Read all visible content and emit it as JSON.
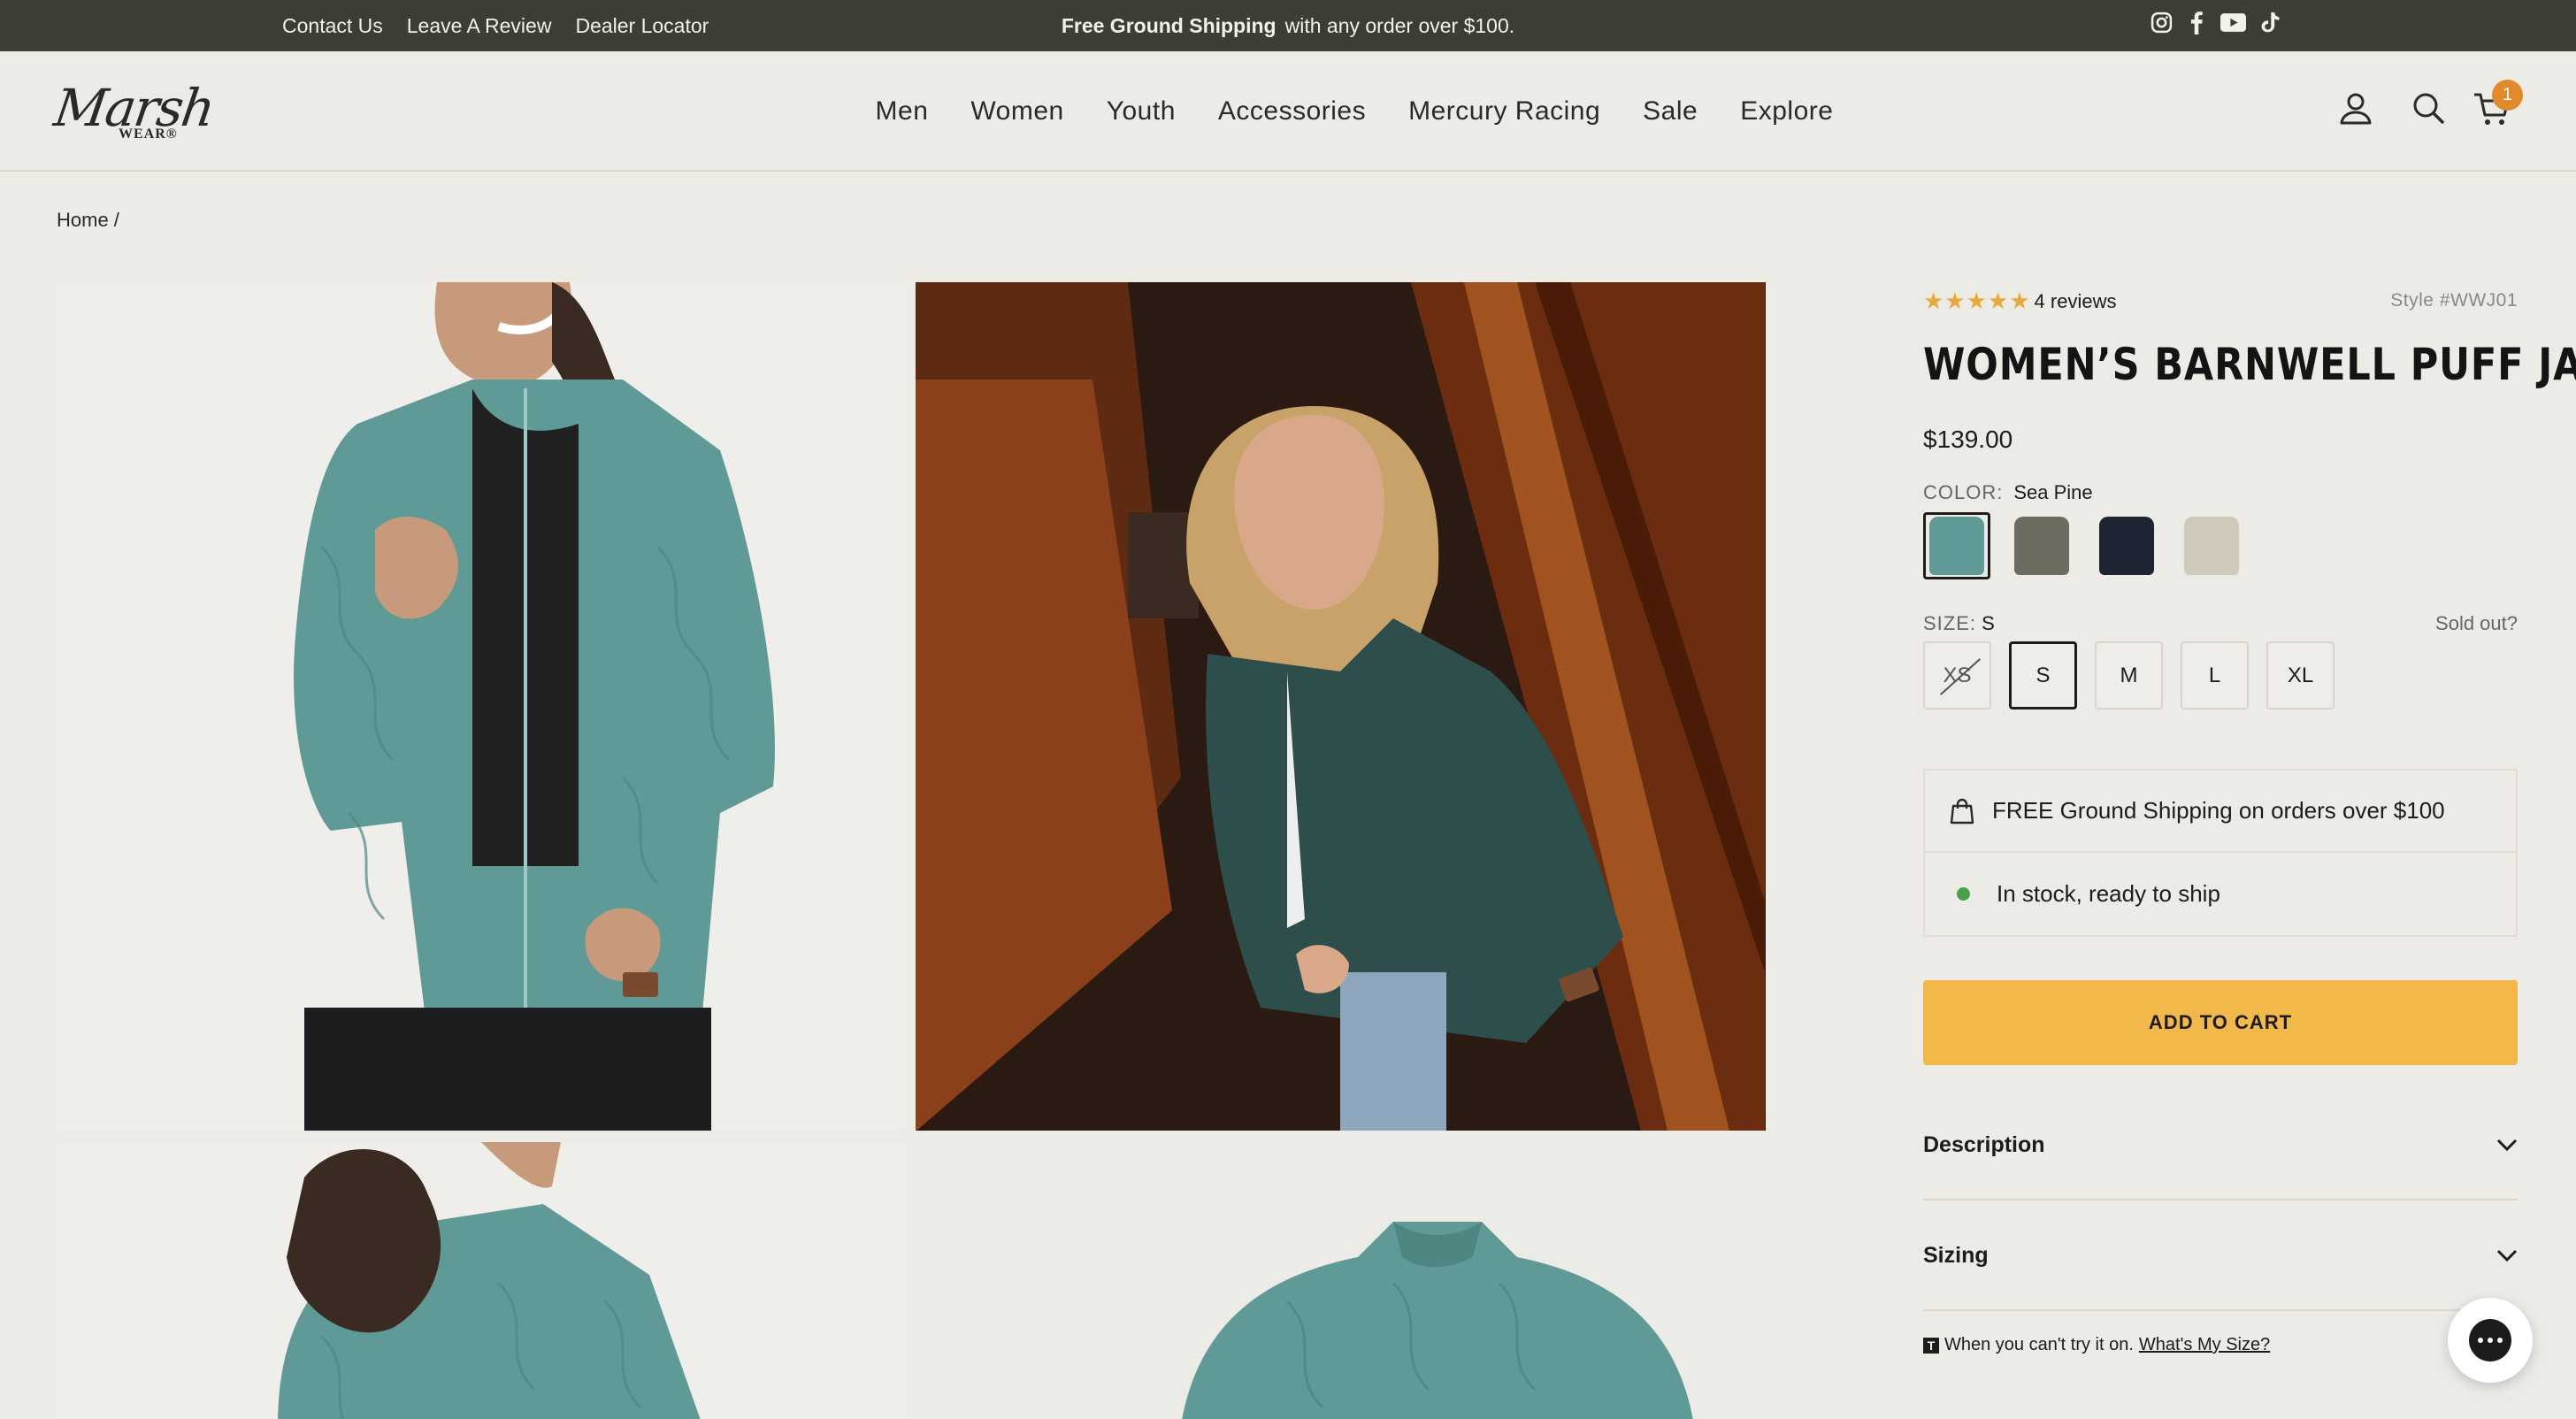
{
  "announcement": {
    "links": [
      "Contact Us",
      "Leave A Review",
      "Dealer Locator"
    ],
    "promo_bold": "Free Ground Shipping",
    "promo_rest": "with any order over $100.",
    "social_icons": [
      "instagram-icon",
      "facebook-icon",
      "youtube-icon",
      "tiktok-icon"
    ]
  },
  "header": {
    "logo_script": "Marsh",
    "logo_sub": "WEAR®",
    "nav": [
      "Men",
      "Women",
      "Youth",
      "Accessories",
      "Mercury Racing",
      "Sale",
      "Explore"
    ],
    "cart_count": "1"
  },
  "breadcrumb": "Home /",
  "product": {
    "rating_stars": 5,
    "reviews": "4 reviews",
    "style": "Style #WWJ01",
    "title": "WOMEN’S BARNWELL PUFF JACKET",
    "price": "$139.00",
    "color_label": "COLOR:",
    "color_value": "Sea Pine",
    "swatches": [
      {
        "name": "Sea Pine",
        "color": "#5f9a96",
        "selected": true
      },
      {
        "name": "Camo",
        "color": "#6e6b60",
        "selected": false
      },
      {
        "name": "Navy",
        "color": "#1f2433",
        "selected": false
      },
      {
        "name": "Stone",
        "color": "#cfc9bb",
        "selected": false
      }
    ],
    "size_label": "SIZE:",
    "size_value": "S",
    "sold_out_link": "Sold out?",
    "sizes": [
      {
        "label": "XS",
        "state": "out"
      },
      {
        "label": "S",
        "state": "selected"
      },
      {
        "label": "M",
        "state": "available"
      },
      {
        "label": "L",
        "state": "available"
      },
      {
        "label": "XL",
        "state": "available"
      }
    ],
    "shipping_note": "FREE Ground Shipping on orders over $100",
    "stock_note": "In stock, ready to ship",
    "add_to_cart": "ADD TO CART",
    "accordion": [
      "Description",
      "Sizing"
    ],
    "fit_note": "When you can't try it on.",
    "fit_link": "What's My Size?",
    "fit_badge": "T"
  },
  "colors": {
    "announce_bg": "#3c3e33",
    "page_bg": "#edebe6",
    "accent_button": "#f2b94a",
    "star": "#e9a83b",
    "cart_badge": "#e08a2c",
    "stock_dot": "#4aa14a"
  }
}
